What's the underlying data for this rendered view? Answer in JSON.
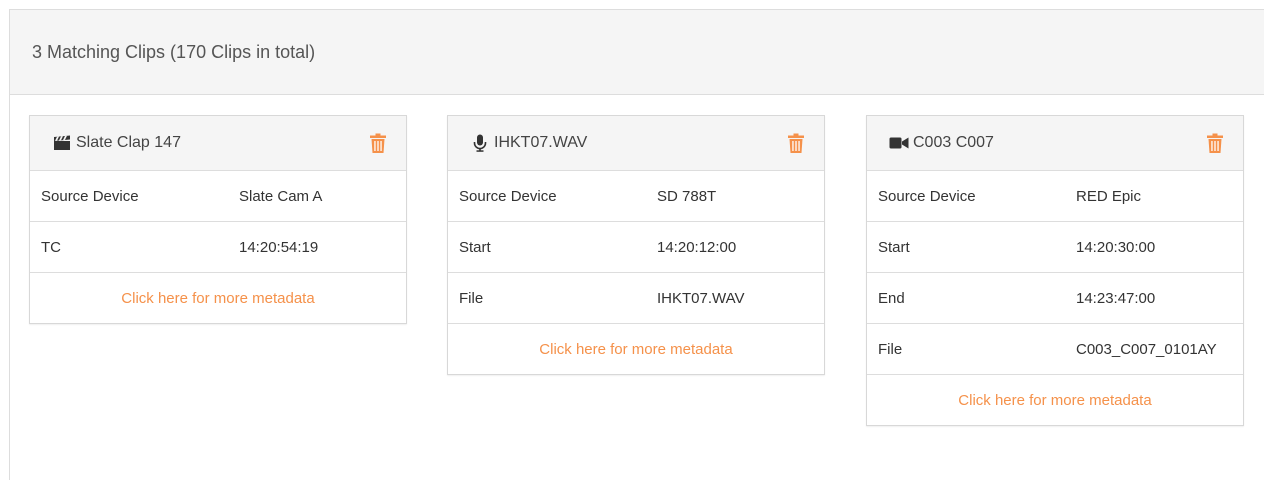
{
  "header": {
    "title": "3 Matching Clips (170 Clips in total)"
  },
  "colors": {
    "accent": "#f5914a",
    "heading_bg": "#f5f5f5",
    "border": "#dddddd"
  },
  "cards": [
    {
      "icon": "clapperboard-icon",
      "title": "Slate Clap 147",
      "rows": [
        {
          "key": "Source Device",
          "value": "Slate Cam A"
        },
        {
          "key": "TC",
          "value": "14:20:54:19"
        }
      ],
      "more_label": "Click here for more metadata"
    },
    {
      "icon": "microphone-icon",
      "title": "IHKT07.WAV",
      "rows": [
        {
          "key": "Source Device",
          "value": "SD 788T"
        },
        {
          "key": "Start",
          "value": "14:20:12:00"
        },
        {
          "key": "File",
          "value": "IHKT07.WAV"
        }
      ],
      "more_label": "Click here for more metadata"
    },
    {
      "icon": "video-camera-icon",
      "title": "C003 C007",
      "rows": [
        {
          "key": "Source Device",
          "value": "RED Epic"
        },
        {
          "key": "Start",
          "value": "14:20:30:00"
        },
        {
          "key": "End",
          "value": "14:23:47:00"
        },
        {
          "key": "File",
          "value": "C003_C007_0101AY"
        }
      ],
      "more_label": "Click here for more metadata"
    }
  ]
}
